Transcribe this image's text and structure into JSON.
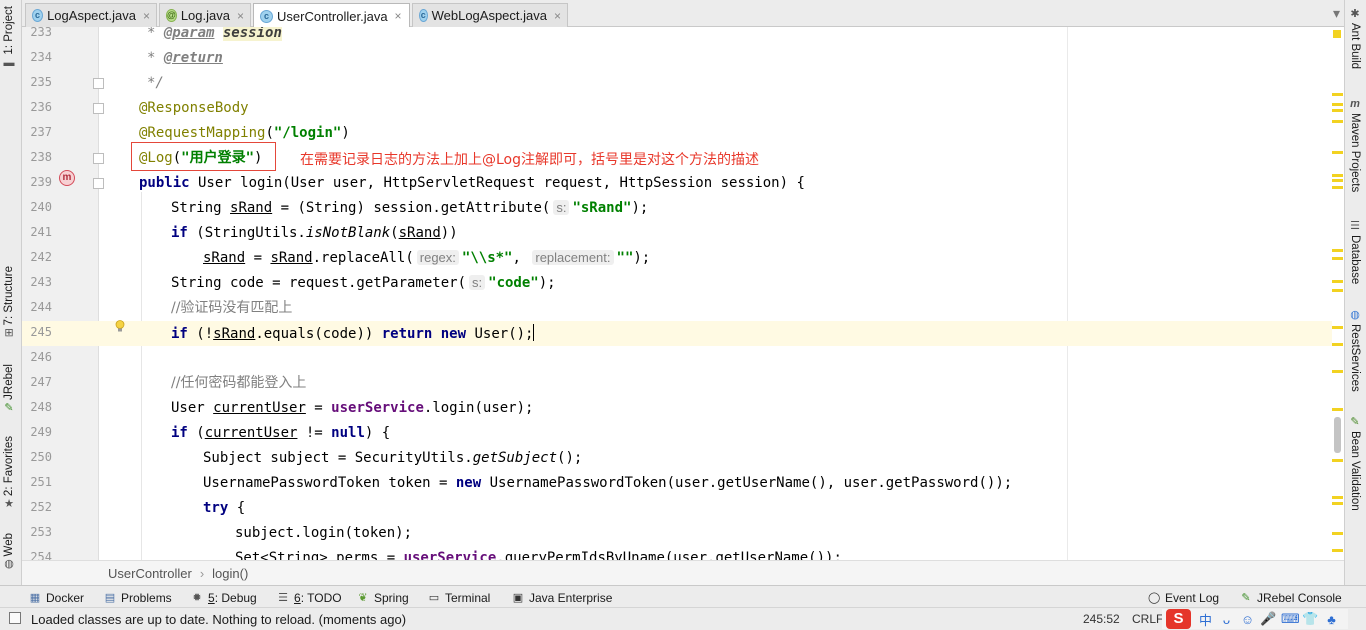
{
  "tabs": [
    {
      "label": "LogAspect.java",
      "icon": "java-class-icon",
      "active": false
    },
    {
      "label": "Log.java",
      "icon": "annotation-icon",
      "active": false
    },
    {
      "label": "UserController.java",
      "icon": "java-class-icon",
      "active": true
    },
    {
      "label": "WebLogAspect.java",
      "icon": "java-class-icon",
      "active": false
    }
  ],
  "left_tools": {
    "project": "1: Project",
    "structure": "7: Structure",
    "jrebel": "JRebel",
    "favorites": "2: Favorites",
    "web": "Web"
  },
  "right_tools": {
    "ant": "Ant Build",
    "maven": "Maven Projects",
    "database": "Database",
    "rest": "RestServices",
    "bean": "Bean Validation"
  },
  "editor": {
    "line_numbers": [
      "233",
      "234",
      "235",
      "236",
      "237",
      "238",
      "239",
      "240",
      "241",
      "242",
      "243",
      "244",
      "245",
      "246",
      "247",
      "248",
      "249",
      "250",
      "251",
      "252",
      "253",
      "254"
    ],
    "caret_line": "245",
    "annotation_note": "在需要记录日志的方法上加上@Log注解即可，括号里是对这个方法的描述",
    "method_marker": "m",
    "code": {
      "l233_star": "* ",
      "l233_tag": "@param",
      "l233_arg": "session",
      "l234_star": "* ",
      "l234_tag": "@return",
      "l235": "*/",
      "l236": "@ResponseBody",
      "l237_ann": "@RequestMapping",
      "l237_open": "(",
      "l237_str": "\"/login\"",
      "l237_close": ")",
      "l238_ann": "@Log",
      "l238_open": "(",
      "l238_str": "\"用户登录\"",
      "l238_close": ")",
      "l239_kw": "public",
      "l239_rest": " User login(User user, HttpServletRequest request, HttpSession session) {",
      "l240_a": "String ",
      "l240_var": "sRand",
      "l240_b": " = (String) session.getAttribute(",
      "l240_hint": "s:",
      "l240_str": "\"sRand\"",
      "l240_c": ");",
      "l241_kw": "if",
      "l241_a": " (StringUtils.",
      "l241_method": "isNotBlank",
      "l241_b": "(",
      "l241_var": "sRand",
      "l241_c": "))",
      "l242_var1": "sRand",
      "l242_a": " = ",
      "l242_var2": "sRand",
      "l242_b": ".replaceAll(",
      "l242_hint1": "regex:",
      "l242_str1": "\"\\\\s*\"",
      "l242_comma": ",",
      "l242_hint2": "replacement:",
      "l242_str2": "\"\"",
      "l242_c": ");",
      "l243_a": "String code = request.getParameter(",
      "l243_hint": "s:",
      "l243_str": "\"code\"",
      "l243_b": ");",
      "l244": "//验证码没有匹配上",
      "l245_kw1": "if",
      "l245_a": " (!",
      "l245_var": "sRand",
      "l245_b": ".equals(code)) ",
      "l245_kw2": "return new",
      "l245_c": " User();",
      "l247": "//任何密码都能登入上",
      "l248_a": "User ",
      "l248_var": "currentUser",
      "l248_b": " = ",
      "l248_field": "userService",
      "l248_c": ".login(user);",
      "l249_kw": "if",
      "l249_a": " (",
      "l249_var": "currentUser",
      "l249_b": " != ",
      "l249_kw2": "null",
      "l249_c": ") {",
      "l250_a": "Subject subject = SecurityUtils.",
      "l250_method": "getSubject",
      "l250_b": "();",
      "l251_a": "UsernamePasswordToken token = ",
      "l251_kw": "new",
      "l251_b": " UsernamePasswordToken(user.getUserName(), user.getPassword());",
      "l252_kw": "try",
      "l252_a": " {",
      "l253": "subject.login(token);",
      "l254_a": "Set<String> perms = ",
      "l254_field": "userService",
      "l254_b": ".queryPermIdsByUname(user.getUserName());"
    }
  },
  "breadcrumb": [
    "UserController",
    "login()"
  ],
  "tool_windows": [
    {
      "label": "Docker",
      "mnemonic": "",
      "icon": "docker-icon"
    },
    {
      "label": "Problems",
      "mnemonic": "",
      "icon": "problems-icon"
    },
    {
      "label": ": Debug",
      "mnemonic": "5",
      "icon": "debug-icon"
    },
    {
      "label": ": TODO",
      "mnemonic": "6",
      "icon": "todo-icon"
    },
    {
      "label": "Spring",
      "mnemonic": "",
      "icon": "spring-icon"
    },
    {
      "label": "Terminal",
      "mnemonic": "",
      "icon": "terminal-icon"
    },
    {
      "label": "Java Enterprise",
      "mnemonic": "",
      "icon": "java-enterprise-icon"
    },
    {
      "label": "Event Log",
      "mnemonic": "",
      "icon": "event-log-icon"
    },
    {
      "label": "JRebel Console",
      "mnemonic": "",
      "icon": "jrebel-console-icon"
    }
  ],
  "status": {
    "message": "Loaded classes are up to date. Nothing to reload. (moments ago)",
    "position": "245:52",
    "line_separator": "CRLF",
    "ime_logo": "S",
    "ime_items": [
      "中",
      "ᴗ",
      "☺",
      "🎤",
      "⌨",
      "👕",
      "♣"
    ]
  },
  "colors": {
    "annotation_highlight": "#e4473a",
    "note_text": "#e8372a",
    "keyword": "#000080",
    "string": "#008000",
    "caret_row": "#fffae3"
  }
}
